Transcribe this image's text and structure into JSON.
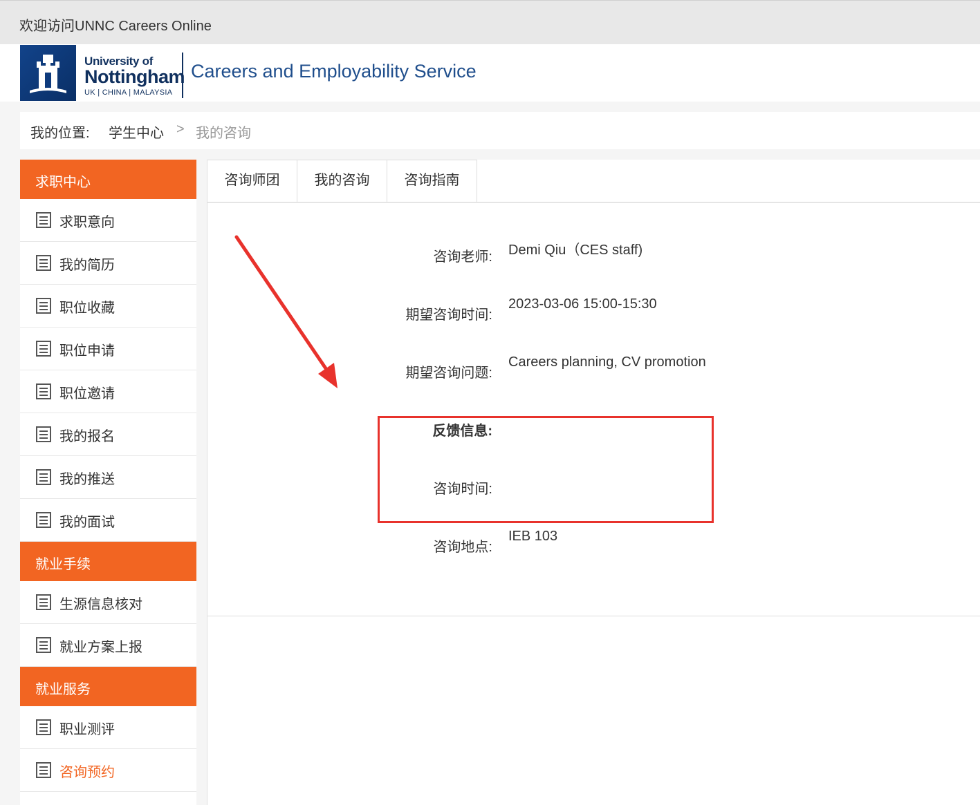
{
  "topbar": {
    "welcome": "欢迎访问UNNC Careers Online"
  },
  "header": {
    "uni_line1": "University of",
    "uni_line2": "Nottingham",
    "uni_line3": "UK | CHINA | MALAYSIA",
    "service": "Careers and Employability Service"
  },
  "breadcrumb": {
    "label": "我的位置:",
    "crumb1": "学生中心",
    "separator": ">",
    "crumb2": "我的咨询"
  },
  "sidebar": {
    "sections": [
      {
        "title": "求职中心",
        "items": [
          "求职意向",
          "我的简历",
          "职位收藏",
          "职位申请",
          "职位邀请",
          "我的报名",
          "我的推送",
          "我的面试"
        ]
      },
      {
        "title": "就业手续",
        "items": [
          "生源信息核对",
          "就业方案上报"
        ]
      },
      {
        "title": "就业服务",
        "items": [
          "职业测评",
          "咨询预约"
        ]
      }
    ],
    "active_item": "咨询预约"
  },
  "tabs": [
    "咨询师团",
    "我的咨询",
    "咨询指南"
  ],
  "details": {
    "advisor_label": "咨询老师:",
    "advisor_value": "Demi Qiu（CES staff)",
    "time_label": "期望咨询时间:",
    "time_value": "2023-03-06 15:00-15:30",
    "topic_label": "期望咨询问题:",
    "topic_value": "Careers planning, CV promotion",
    "feedback_label": "反馈信息:",
    "consult_time_label": "咨询时间:",
    "location_label": "咨询地点:",
    "location_value": "IEB 103"
  },
  "colors": {
    "accent": "#f26522",
    "annotation": "#e8322c",
    "brand": "#10305e"
  }
}
